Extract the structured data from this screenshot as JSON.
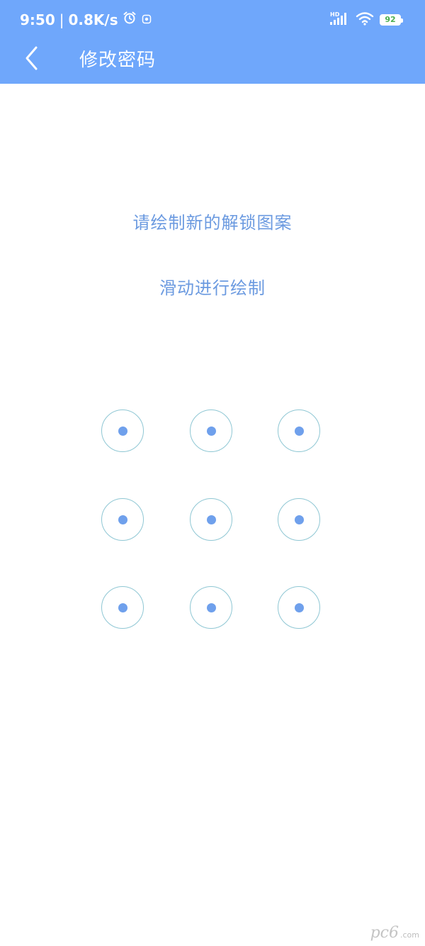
{
  "status_bar": {
    "time": "9:50",
    "separator": "|",
    "network_speed": "0.8K/s",
    "signal_badge": "HD",
    "battery_level": "92"
  },
  "header": {
    "title": "修改密码"
  },
  "prompt": {
    "main": "请绘制新的解锁图案",
    "sub": "滑动进行绘制"
  },
  "pattern": {
    "nodes": [
      1,
      2,
      3,
      4,
      5,
      6,
      7,
      8,
      9
    ],
    "ring_color": "#8fc7d4",
    "dot_color": "#6fa0ec"
  },
  "colors": {
    "header_bg": "#6fa7fb",
    "prompt_text": "#6b9ae0"
  },
  "watermark": {
    "mark": "pc6",
    "text": ".com"
  }
}
